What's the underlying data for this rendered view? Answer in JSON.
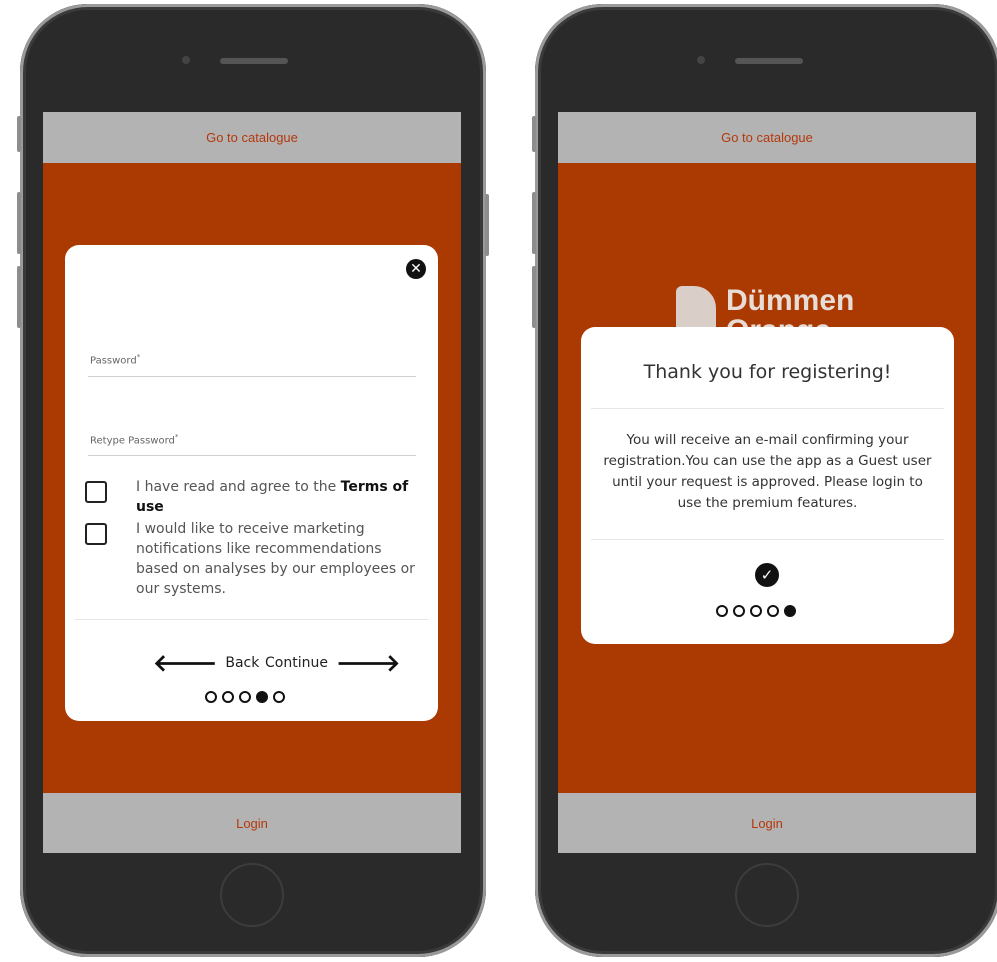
{
  "left_phone": {
    "top_bar": "Go to catalogue",
    "bottom_bar": "Login",
    "modal": {
      "close_icon": "close-icon",
      "password_label": "Password",
      "retype_label": "Retype Password",
      "required_mark": "*",
      "terms_text": "I have read and agree to the",
      "terms_link": "Terms of use",
      "marketing_text": "I would like to receive marketing notifications like recommendations based on analyses by our employees or our systems.",
      "back_label": "Back",
      "continue_label": "Continue",
      "step_current": 4,
      "step_total": 5
    }
  },
  "right_phone": {
    "top_bar": "Go to catalogue",
    "bottom_bar": "Login",
    "logo_line1": "Dümmen",
    "logo_line2": "Orange",
    "modal": {
      "title": "Thank you for registering!",
      "message": "You will receive an e-mail confirming your registration.You can use the app as a Guest user until your request is approved. Please login to use the premium features.",
      "check_icon": "check-circle-icon",
      "step_current": 5,
      "step_total": 5
    }
  },
  "colors": {
    "brand_orange": "#ab3a02",
    "bar_gray": "#b3b3b3",
    "bar_text": "#b5380d"
  }
}
